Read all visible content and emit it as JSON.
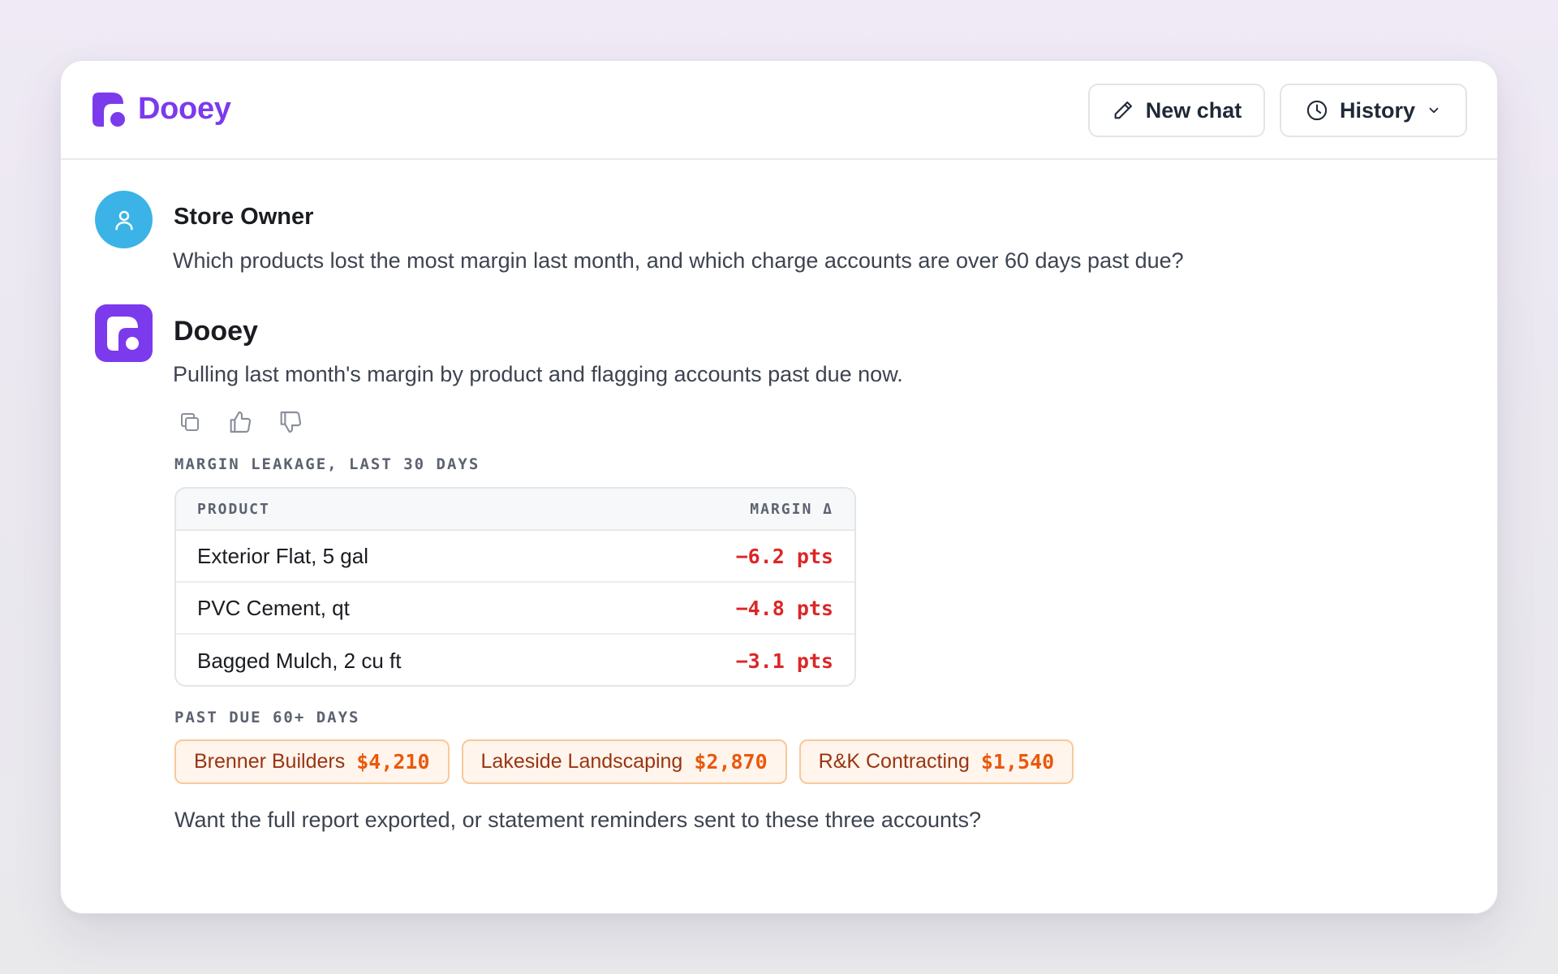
{
  "app": {
    "brand_name": "Dooey",
    "accent_color": "#7c3aed"
  },
  "header": {
    "new_chat_label": "New chat",
    "new_chat_icon": "pencil-icon",
    "history_label": "History",
    "history_icon": "clock-icon",
    "history_dropdown_icon": "chevron-down-icon"
  },
  "conversation": {
    "user_message": {
      "sender": "Store Owner",
      "avatar_icon": "user-icon",
      "text": "Which products lost the most margin last month, and which charge accounts are over 60 days past due?"
    },
    "assistant_message": {
      "sender": "Dooey",
      "intro": "Pulling last month's margin by product and flagging accounts past due now.",
      "actions": [
        "copy-icon",
        "thumbs-up-icon",
        "thumbs-down-icon"
      ],
      "margin_section_label": "MARGIN LEAKAGE, LAST 30 DAYS",
      "table": {
        "headers": {
          "product": "PRODUCT",
          "margin": "MARGIN Δ"
        },
        "rows": [
          {
            "product": "Exterior Flat, 5 gal",
            "margin": "−6.2 pts"
          },
          {
            "product": "PVC Cement, qt",
            "margin": "−4.8 pts"
          },
          {
            "product": "Bagged Mulch, 2 cu ft",
            "margin": "−3.1 pts"
          }
        ],
        "negative_color": "#dc2626"
      },
      "past_due_section_label": "PAST DUE 60+ DAYS",
      "past_due_accounts": [
        {
          "name": "Brenner Builders",
          "amount": "$4,210"
        },
        {
          "name": "Lakeside Landscaping",
          "amount": "$2,870"
        },
        {
          "name": "R&K Contracting",
          "amount": "$1,540"
        }
      ],
      "followup": "Want the full report exported, or statement reminders sent to these three accounts?"
    }
  }
}
